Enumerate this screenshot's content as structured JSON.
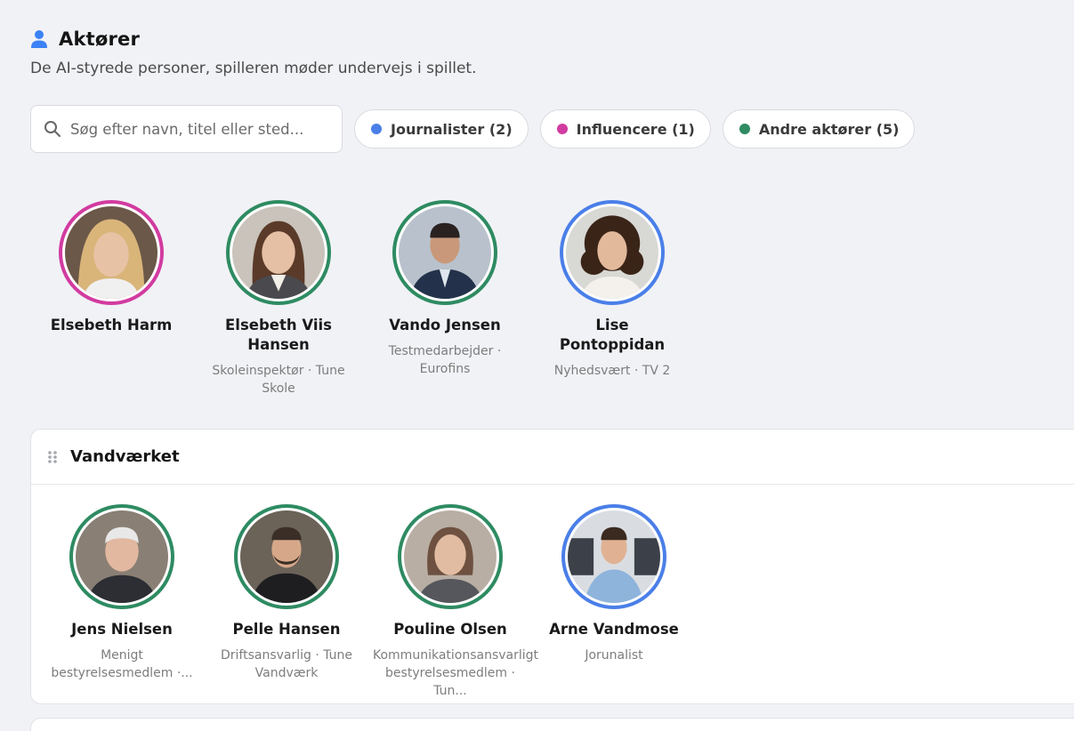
{
  "header": {
    "title": "Aktører",
    "subtitle": "De AI-styrede personer, spilleren møder undervejs i spillet.",
    "icon": "person-icon"
  },
  "search": {
    "placeholder": "Søg efter navn, titel eller sted...",
    "value": "",
    "icon": "search-icon"
  },
  "filters": [
    {
      "label": "Journalister (2)",
      "color": "#4a7fe8"
    },
    {
      "label": "Influencere (1)",
      "color": "#d23ba0"
    },
    {
      "label": "Andre aktører (5)",
      "color": "#2e8b62"
    }
  ],
  "colors": {
    "journalist": "#4a7fe8",
    "influencer": "#d23ba0",
    "other": "#2e8b62"
  },
  "people": [
    {
      "name": "Elsebeth Harm",
      "role": "",
      "category": "influencer"
    },
    {
      "name": "Elsebeth Viis Hansen",
      "role": "Skoleinspektør · Tune Skole",
      "category": "other"
    },
    {
      "name": "Vando Jensen",
      "role": "Testmedarbejder · Eurofins",
      "category": "other"
    },
    {
      "name": "Lise Pontoppidan",
      "role": "Nyhedsvært · TV 2",
      "category": "journalist"
    }
  ],
  "groups": [
    {
      "title": "Vandværket",
      "drag_icon": "drag-handle-icon",
      "people": [
        {
          "name": "Jens Nielsen",
          "role_line1": "Menigt",
          "role_line2": "bestyrelsesmedlem ·...",
          "category": "other"
        },
        {
          "name": "Pelle Hansen",
          "role_line1": "Driftsansvarlig · Tune",
          "role_line2": "Vandværk",
          "category": "other"
        },
        {
          "name": "Pouline Olsen",
          "role_line1": "Kommunikationsansvarligt",
          "role_line2": "bestyrelsesmedlem · Tun...",
          "category": "other"
        },
        {
          "name": "Arne Vandmose",
          "role_line1": "Jorunalist",
          "role_line2": "",
          "category": "journalist"
        }
      ]
    }
  ]
}
